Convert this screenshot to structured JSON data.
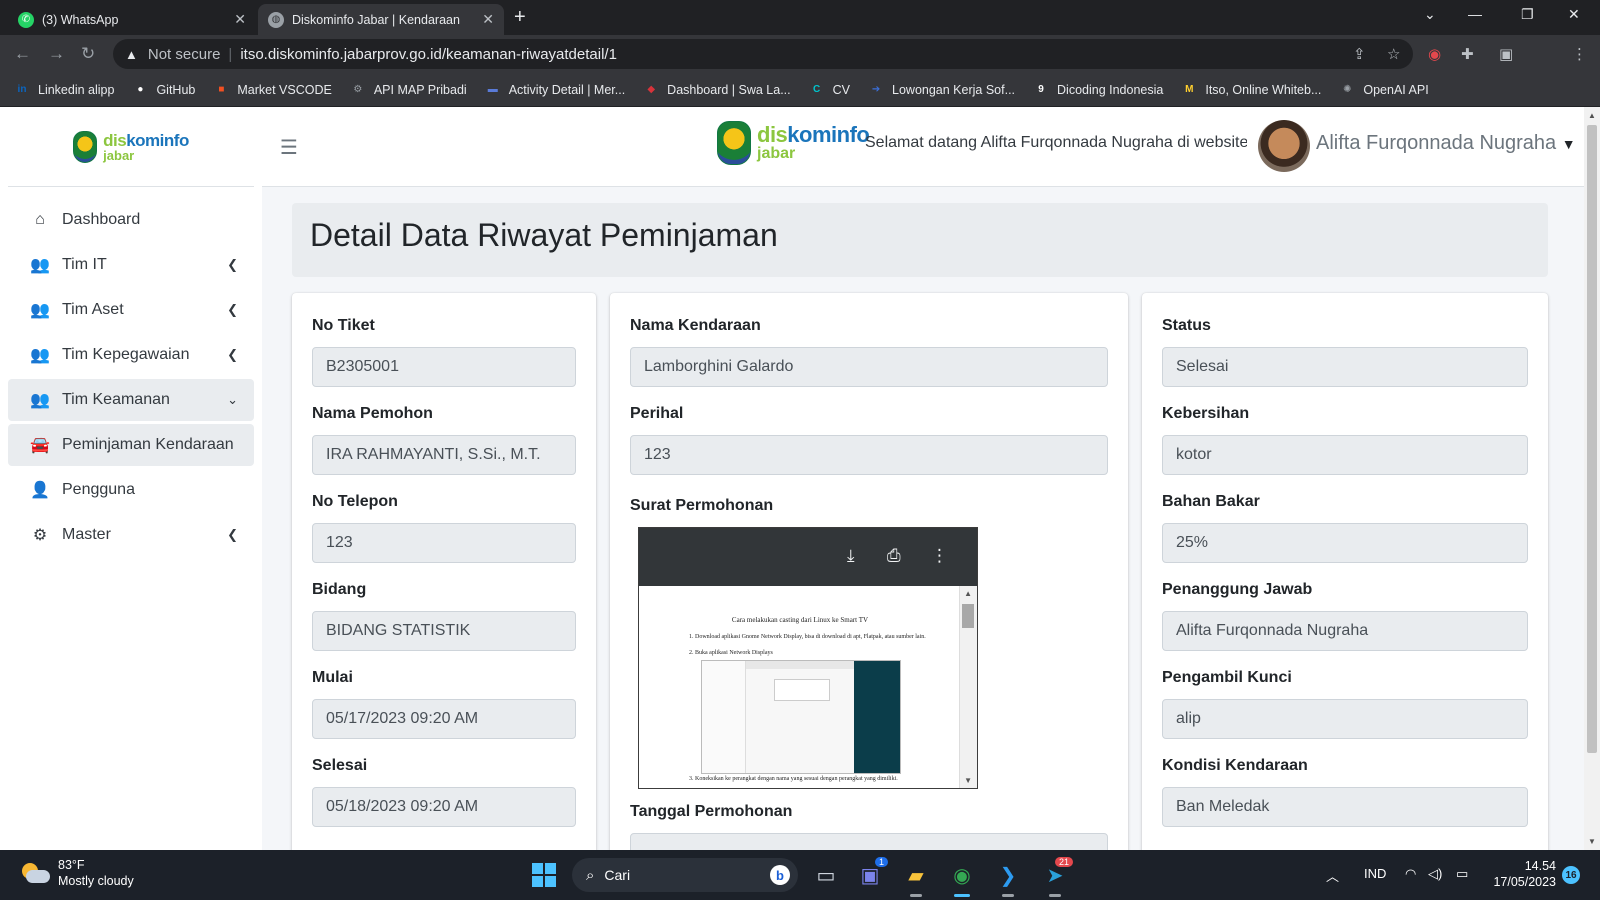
{
  "browser": {
    "tabs": [
      {
        "title": "(3) WhatsApp"
      },
      {
        "title": "Diskominfo Jabar | Kendaraan"
      }
    ],
    "address": {
      "security": "Not secure",
      "url": "itso.diskominfo.jabarprov.go.id/keamanan-riwayatdetail/1"
    },
    "bookmarks": [
      {
        "label": "Linkedin alipp",
        "icon": "linkedin-icon",
        "color": "#0a66c2",
        "glyph": "in"
      },
      {
        "label": "GitHub",
        "icon": "github-icon",
        "color": "#ffffff",
        "glyph": "●"
      },
      {
        "label": "Market VSCODE",
        "icon": "microsoft-icon",
        "color": "#f25022",
        "glyph": "■"
      },
      {
        "label": "API MAP Pribadi",
        "icon": "gear-icon",
        "color": "#9aa0a6",
        "glyph": "⚙"
      },
      {
        "label": "Activity Detail | Mer...",
        "icon": "activity-icon",
        "color": "#5a7bd8",
        "glyph": "▬"
      },
      {
        "label": "Dashboard | Swa La...",
        "icon": "dashboard-icon",
        "color": "#d8333a",
        "glyph": "◆"
      },
      {
        "label": "CV",
        "icon": "canva-icon",
        "color": "#00c4cc",
        "glyph": "C"
      },
      {
        "label": "Lowongan Kerja Sof...",
        "icon": "arrow-icon",
        "color": "#3b6fd8",
        "glyph": "➔"
      },
      {
        "label": "Dicoding Indonesia",
        "icon": "dicoding-icon",
        "color": "#ffffff",
        "glyph": "9"
      },
      {
        "label": "Itso, Online Whiteb...",
        "icon": "miro-icon",
        "color": "#ffd02f",
        "glyph": "M"
      },
      {
        "label": "OpenAI API",
        "icon": "openai-icon",
        "color": "#9aa0a6",
        "glyph": "✺"
      }
    ]
  },
  "brand": {
    "word1": "dis",
    "word2": "kominfo",
    "word3": "jabar"
  },
  "sidebar": {
    "items": [
      {
        "label": "Dashboard",
        "icon": "home-icon",
        "glyph": "⌂"
      },
      {
        "label": "Tim IT",
        "icon": "users-icon",
        "glyph": "👥",
        "caret": "❮"
      },
      {
        "label": "Tim Aset",
        "icon": "users-icon",
        "glyph": "👥",
        "caret": "❮"
      },
      {
        "label": "Tim Kepegawaian",
        "icon": "users-icon",
        "glyph": "👥",
        "caret": "❮"
      },
      {
        "label": "Tim Keamanan",
        "icon": "users-icon",
        "glyph": "👥",
        "caret": "⌄"
      },
      {
        "label": "Peminjaman Kendaraan",
        "icon": "car-icon",
        "glyph": "🚘"
      },
      {
        "label": "Pengguna",
        "icon": "user-plus-icon",
        "glyph": "👤"
      },
      {
        "label": "Master",
        "icon": "gear-icon",
        "glyph": "⚙",
        "caret": "❮"
      }
    ]
  },
  "topbar": {
    "welcome": "Selamat datang Alifta Furqonnada Nugraha di website IT",
    "user_name": "Alifta Furqonnada Nugraha"
  },
  "page": {
    "title": "Detail Data Riwayat Peminjaman"
  },
  "form": {
    "col1": [
      {
        "label": "No Tiket",
        "value": "B2305001"
      },
      {
        "label": "Nama Pemohon",
        "value": "IRA RAHMAYANTI, S.Si., M.T."
      },
      {
        "label": "No Telepon",
        "value": "123"
      },
      {
        "label": "Bidang",
        "value": "BIDANG STATISTIK"
      },
      {
        "label": "Mulai",
        "value": "05/17/2023 09:20 AM"
      },
      {
        "label": "Selesai",
        "value": "05/18/2023 09:20 AM"
      }
    ],
    "col2": [
      {
        "label": "Nama Kendaraan",
        "value": "Lamborghini Galardo"
      },
      {
        "label": "Perihal",
        "value": "123"
      }
    ],
    "surat_label": "Surat Permohonan",
    "tanggal_label": "Tanggal Permohonan",
    "col3": [
      {
        "label": "Status",
        "value": "Selesai"
      },
      {
        "label": "Kebersihan",
        "value": "kotor"
      },
      {
        "label": "Bahan Bakar",
        "value": "25%"
      },
      {
        "label": "Penanggung Jawab",
        "value": "Alifta Furqonnada Nugraha"
      },
      {
        "label": "Pengambil Kunci",
        "value": "alip"
      },
      {
        "label": "Kondisi Kendaraan",
        "value": "Ban Meledak"
      }
    ]
  },
  "pdf": {
    "doc_title": "Cara melakukan casting dari Linux ke Smart TV",
    "lines": [
      "1.   Download aplikasi Gnome Network Display, bisa di download di apt, Flatpak, atau sumber lain.",
      "2.   Buka aplikasi Network Displays",
      "3.   Koneksikan ke perangkat dengan nama yang sesuai dengan perangkat yang dimiliki."
    ]
  },
  "taskbar": {
    "temp": "83°F",
    "weather": "Mostly cloudy",
    "search": "Cari",
    "lang": "IND",
    "time": "14.54",
    "date": "17/05/2023",
    "notif_count": "16",
    "teams_badge": "1",
    "telegram_badge": "21"
  }
}
